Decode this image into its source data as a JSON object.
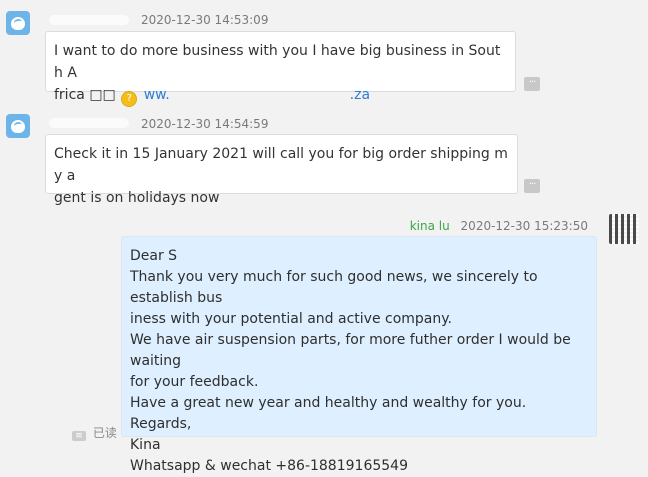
{
  "messages": [
    {
      "sender_name": "",
      "timestamp": "2020-12-30 14:53:09",
      "lines": [
        "I want to do more business with you I have big business in South A",
        "frica"
      ],
      "inline_glyph": "□□",
      "inline_icon": "question-emoji-icon",
      "link_prefix": "ww.",
      "link_suffix": ".za",
      "more_label": "···"
    },
    {
      "sender_name": "",
      "timestamp": "2020-12-30 14:54:59",
      "lines": [
        "Check it in 15 January 2021 will call you for big order shipping my a",
        "gent is on holidays now"
      ],
      "more_label": "···"
    }
  ],
  "self_message": {
    "sender_name": "kina lu",
    "timestamp": "2020-12-30 15:23:50",
    "lines": [
      "Dear S",
      "Thank you very much for such good news, we sincerely to establish bus",
      "iness with your potential and active company.",
      "We have air suspension parts, for more futher order I would be waiting",
      " for your feedback.",
      "Have a great new year and healthy and wealthy for you.",
      "Regards,",
      "Kina",
      "Whatsapp & wechat +86-18819165549"
    ],
    "status": "已读"
  },
  "colors": {
    "background": "#f2f2f2",
    "incoming_bubble": "#ffffff",
    "outgoing_bubble": "#deefff",
    "link": "#2f7cd3",
    "self_name": "#3ba54a",
    "avatar": "#6db5e8"
  }
}
